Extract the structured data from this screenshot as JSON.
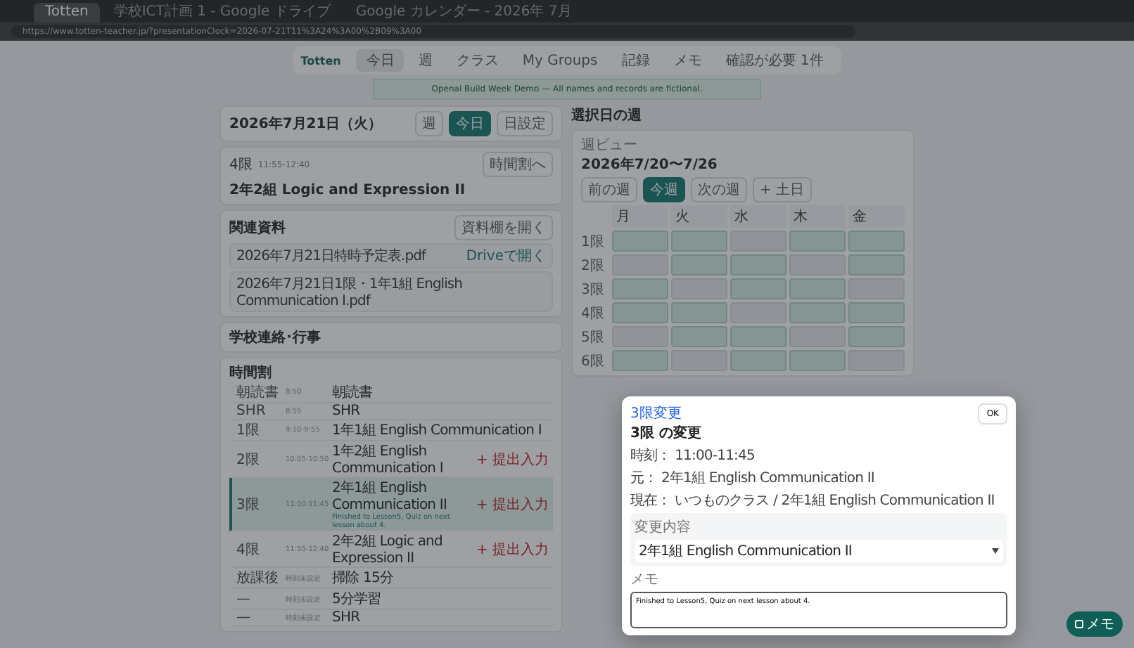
{
  "browser": {
    "tabs": [
      {
        "title": "Totten",
        "selected": true
      },
      {
        "title": "学校ICT計画 1 - Google ドライブ",
        "selected": false
      },
      {
        "title": "Google カレンダー - 2026年 7月",
        "selected": false
      }
    ],
    "url": "https://www.totten-teacher.jp/?presentationClock=2026-07-21T11%3A24%3A00%2B09%3A00"
  },
  "nav": {
    "logo": "Totten",
    "items": [
      {
        "label": "今日",
        "selected": true
      },
      {
        "label": "週",
        "selected": false
      },
      {
        "label": "クラス",
        "selected": false
      },
      {
        "label": "My Groups",
        "selected": false
      },
      {
        "label": "記録",
        "selected": false
      },
      {
        "label": "メモ",
        "selected": false
      },
      {
        "label": "確認が必要 1件",
        "selected": false
      }
    ]
  },
  "banner": "Openai Build Week Demo — All names and records are fictional.",
  "day": {
    "date": "2026年7月21日（火）",
    "buttons": [
      {
        "label": "週",
        "selected": false
      },
      {
        "label": "今日",
        "selected": true
      },
      {
        "label": "日設定",
        "selected": false
      }
    ]
  },
  "next_class": {
    "period": "4限",
    "time": "11:55-12:40",
    "title": "2年2組 Logic and Expression II",
    "button": "時間割へ"
  },
  "materials": {
    "title": "関連資料",
    "button": "資料棚を開く",
    "files": [
      {
        "name": "2026年7月21日特時予定表.pdf",
        "action": "Driveで開く"
      },
      {
        "name": "2026年7月21日1限・1年1組 English Communication I.pdf"
      }
    ]
  },
  "notices": {
    "title": "学校連絡･行事"
  },
  "timetable": {
    "title": "時間割",
    "rows": [
      {
        "period": "朝読書",
        "time": "8:50",
        "subject": "朝読書",
        "selected": false
      },
      {
        "period": "SHR",
        "time": "8:55",
        "subject": "SHR",
        "selected": false
      },
      {
        "period": "1限",
        "time": "9:10-9:55",
        "subject": "1年1組 English Communication I",
        "selected": false
      },
      {
        "period": "2限",
        "time": "10:05-10:50",
        "subject": "1年2組 English Communication I",
        "action": "+ 提出入力",
        "selected": false
      },
      {
        "period": "3限",
        "time": "11:00-11:45",
        "subject": "2年1組 English Communication II",
        "note": "Finished to Lesson5, Quiz on next lesson about 4.",
        "action": "+ 提出入力",
        "selected": true
      },
      {
        "period": "4限",
        "time": "11:55-12:40",
        "subject": "2年2組 Logic and Expression II",
        "action": "+ 提出入力",
        "selected": false
      },
      {
        "period": "放課後",
        "time": "時刻未設定",
        "subject": "掃除 15分",
        "selected": false
      },
      {
        "period": "—",
        "time": "時刻未設定",
        "subject": "5分学習",
        "selected": false
      },
      {
        "period": "—",
        "time": "時刻未設定",
        "subject": "SHR",
        "selected": false
      }
    ]
  },
  "week": {
    "title": "選択日の週",
    "label": "週ビュー",
    "range": "2026年7/20〜7/26",
    "buttons": [
      {
        "label": "前の週",
        "selected": false
      },
      {
        "label": "今週",
        "selected": true
      },
      {
        "label": "次の週",
        "selected": false
      },
      {
        "label": "+ 土日",
        "selected": false
      }
    ],
    "days": [
      "月",
      "火",
      "水",
      "木",
      "金"
    ],
    "periods": [
      "1限",
      "2限",
      "3限",
      "4限",
      "5限",
      "6限"
    ]
  },
  "dialog": {
    "tag": "3限変更",
    "title": "3限 の変更",
    "close": "OK",
    "info": [
      "時刻： 11:00-11:45",
      "元： 2年1組 English Communication II",
      "現在： いつものクラス / 2年1組 English Communication II"
    ],
    "change_label": "変更内容",
    "change_value": "2年1組 English Communication II",
    "memo_label": "メモ",
    "memo_value": "Finished to Lesson5, Quiz on next lesson about 4."
  },
  "fab": "メモ"
}
